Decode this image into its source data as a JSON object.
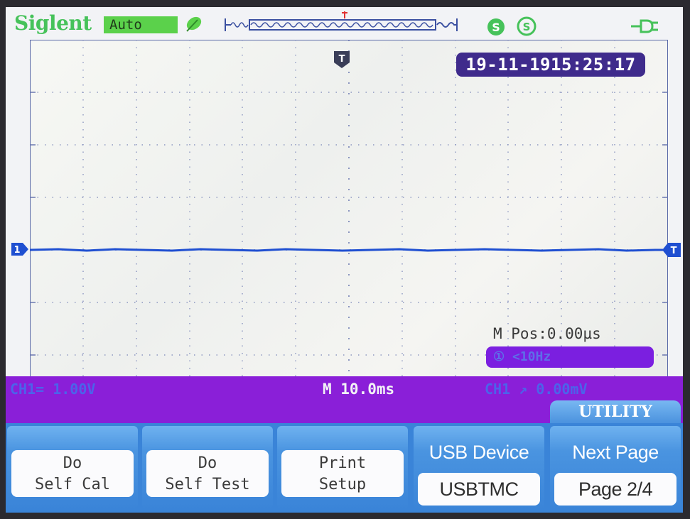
{
  "top_bar": {
    "brand": "Siglent",
    "acquire_mode": "Auto",
    "icons": [
      "leaf-icon",
      "time-window-icon",
      "trigger-position-marker",
      "sync-icon",
      "sync-icon",
      "plug-icon"
    ]
  },
  "display": {
    "datetime": "19-11-1915:25:17",
    "trigger_position_marker": "T",
    "ch1_marker": "1",
    "trigger_level_marker": "T",
    "m_pos": "M Pos:0.00µs",
    "frequency": "① <10Hz",
    "trace_color": "#1f4fd1"
  },
  "status_bar": {
    "ch1_scale": "CH1= 1.00V",
    "timebase": "M 10.0ms",
    "trigger": "CH1 ↗ 0.00mV"
  },
  "menu": {
    "title": "UTILITY",
    "softkeys": [
      {
        "line1": "Do",
        "line2": "Self Cal"
      },
      {
        "line1": "Do",
        "line2": "Self Test"
      },
      {
        "line1": "Print",
        "line2": "Setup"
      },
      {
        "top": "USB Device",
        "value": "USBTMC"
      },
      {
        "top": "Next Page",
        "value": "Page 2/4"
      }
    ]
  },
  "colors": {
    "status_bar": "#8a1fd8",
    "softkey_blue": "#3a84d8",
    "datetime_bg": "#3f2b8c",
    "brand_green": "#46c25a"
  }
}
